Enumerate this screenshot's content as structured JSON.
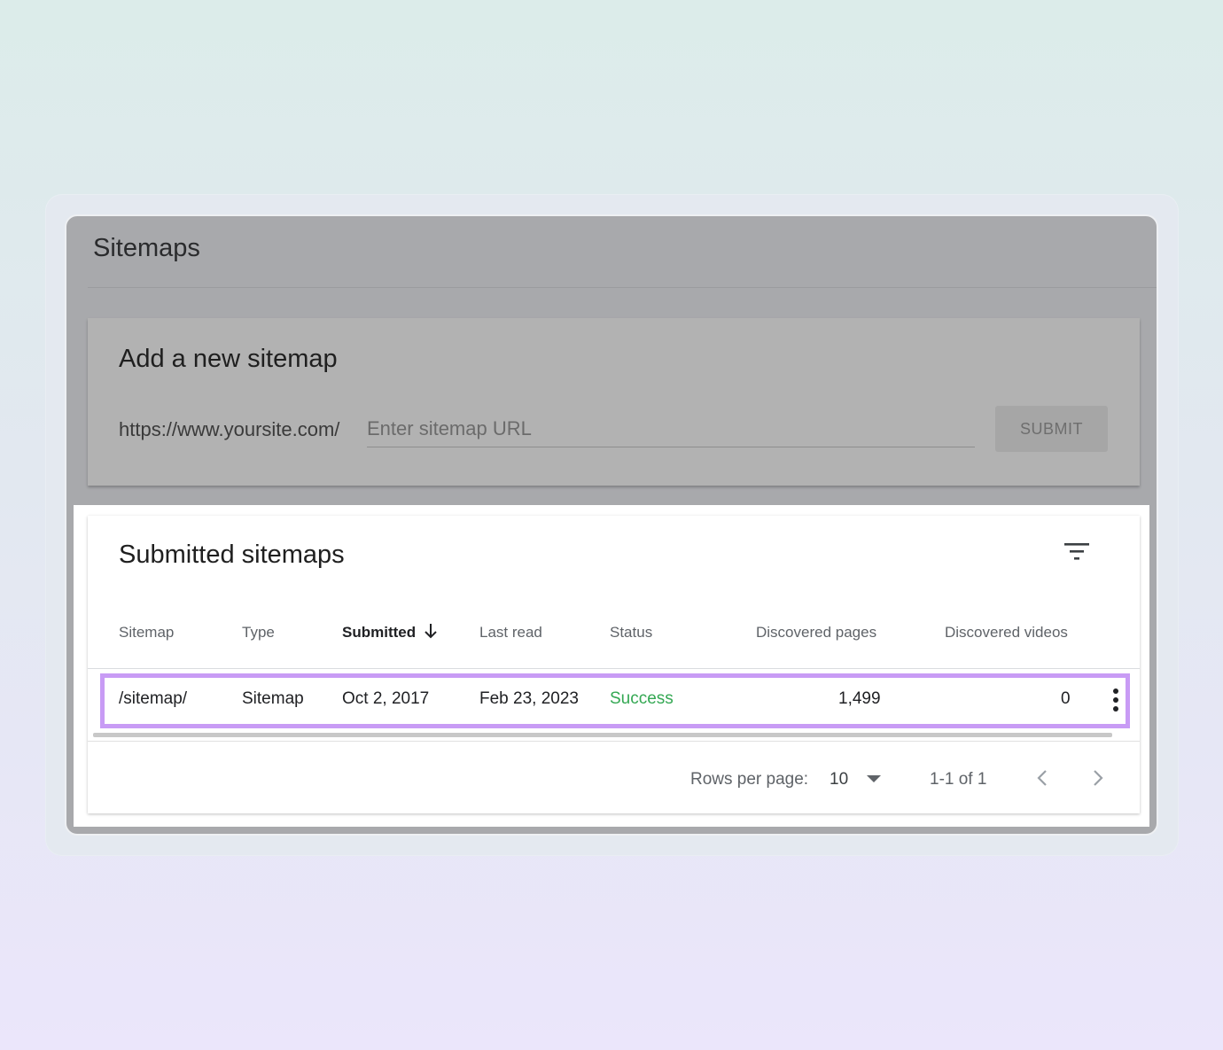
{
  "page": {
    "title": "Sitemaps"
  },
  "add_sitemap": {
    "title": "Add a new sitemap",
    "url_prefix": "https://www.yoursite.com/",
    "input_placeholder": "Enter sitemap URL",
    "input_value": "",
    "submit_label": "SUBMIT"
  },
  "submitted": {
    "title": "Submitted sitemaps",
    "columns": [
      "Sitemap",
      "Type",
      "Submitted",
      "Last read",
      "Status",
      "Discovered pages",
      "Discovered videos"
    ],
    "sorted_column": "Submitted",
    "rows": [
      {
        "sitemap": "/sitemap/",
        "type": "Sitemap",
        "submitted": "Oct 2, 2017",
        "last_read": "Feb 23, 2023",
        "status": "Success",
        "discovered_pages": "1,499",
        "discovered_videos": "0"
      }
    ],
    "pagination": {
      "rows_per_page_label": "Rows per page:",
      "rows_per_page": "10",
      "range": "1-1 of 1"
    }
  },
  "icons": {
    "filter": "filter-icon",
    "sort": "arrow-down-icon",
    "more": "more-vert-icon",
    "dropdown": "caret-down-icon",
    "prev": "chevron-left-icon",
    "next": "chevron-right-icon"
  },
  "colors": {
    "highlight": "#c89bf5",
    "success": "#34a853"
  }
}
